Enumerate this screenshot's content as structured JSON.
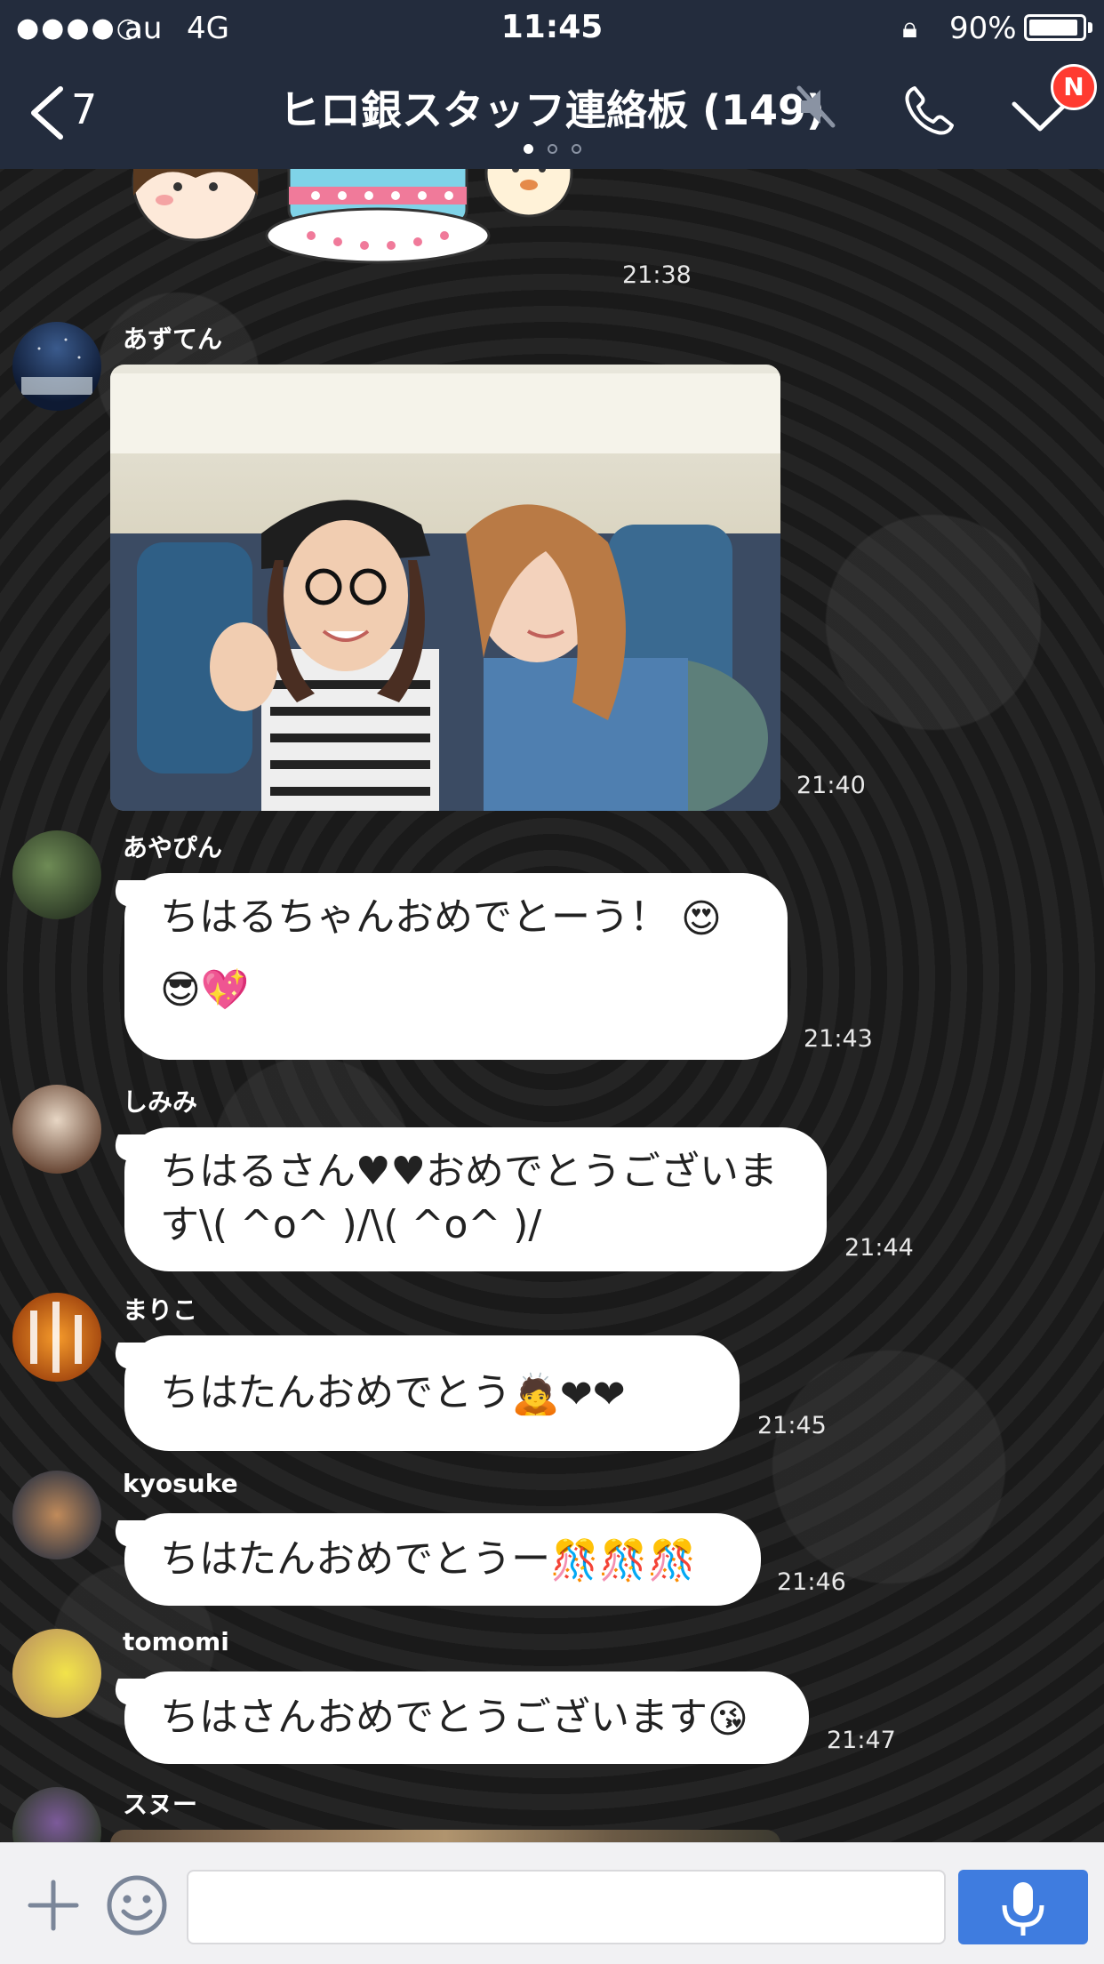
{
  "status_bar": {
    "signal": "●●●●○",
    "carrier": "au",
    "network": "4G",
    "time": "11:45",
    "battery": "90%",
    "battery_level": 0.9
  },
  "header": {
    "back_count": "7",
    "title": "ヒロ銀スタッフ連絡板 (149)",
    "badge": "N",
    "page_dots": 3,
    "active_dot": 0
  },
  "messages": [
    {
      "type": "sticker",
      "time": "21:38"
    },
    {
      "type": "photo",
      "sender": "あずてん",
      "time": "21:40"
    },
    {
      "type": "text",
      "sender": "あやぴん",
      "text": "ちはるちゃんおめでとーう！",
      "emoji_line1": "😍",
      "emoji_line2": "😎💖",
      "time": "21:43"
    },
    {
      "type": "text",
      "sender": "しみみ",
      "text_line1": "ちはるさん♥♥おめでとうございま",
      "text_line2": "す\\( ^o^ )/\\( ^o^ )/",
      "time": "21:44"
    },
    {
      "type": "text",
      "sender": "まりこ",
      "text": "ちはたんおめでとう",
      "emoji": "🙇❤❤",
      "time": "21:45"
    },
    {
      "type": "text",
      "sender": "kyosuke",
      "text": "ちはたんおめでとうー",
      "emoji": "🎊🎊🎊",
      "time": "21:46"
    },
    {
      "type": "text",
      "sender": "tomomi",
      "text": "ちはさんおめでとうございます",
      "emoji": "😘",
      "time": "21:47"
    },
    {
      "type": "photo",
      "sender": "スヌー"
    }
  ],
  "input": {
    "placeholder": ""
  },
  "colors": {
    "header": "#232c3d",
    "mic_button": "#3f7cdf",
    "badge": "#ff3b30"
  }
}
